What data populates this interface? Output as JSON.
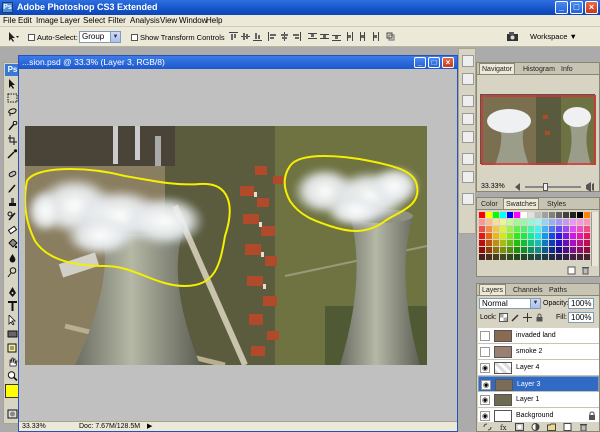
{
  "app": {
    "title": "Adobe Photoshop CS3 Extended",
    "logo": "Ps"
  },
  "menu": [
    "File",
    "Edit",
    "Image",
    "Layer",
    "Select",
    "Filter",
    "Analysis",
    "View",
    "Window",
    "Help"
  ],
  "options": {
    "auto_select_label": "Auto-Select:",
    "auto_select_value": "Group",
    "show_transform_label": "Show Transform Controls",
    "workspace_label": "Workspace"
  },
  "document": {
    "title": "...sion.psd @ 33.3% (Layer 3, RGB/8)",
    "zoom": "33.33%",
    "doc_size": "Doc: 7.67M/128.5M"
  },
  "navigator": {
    "tabs": [
      "Navigator",
      "Histogram",
      "Info"
    ],
    "zoom": "33.33%"
  },
  "swatches": {
    "tabs": [
      "Color",
      "Swatches",
      "Styles"
    ]
  },
  "layers_panel": {
    "tabs": [
      "Layers",
      "Channels",
      "Paths"
    ],
    "blend_mode": "Normal",
    "opacity_label": "Opacity:",
    "opacity_value": "100%",
    "lock_label": "Lock:",
    "fill_label": "Fill:",
    "fill_value": "100%",
    "layers": [
      {
        "name": "invaded land",
        "visible": false,
        "selected": false
      },
      {
        "name": "smoke 2",
        "visible": false,
        "selected": false
      },
      {
        "name": "Layer 4",
        "visible": true,
        "selected": false
      },
      {
        "name": "Layer 3",
        "visible": true,
        "selected": true
      },
      {
        "name": "Layer 1",
        "visible": true,
        "selected": false
      },
      {
        "name": "Background",
        "visible": true,
        "selected": false
      }
    ]
  },
  "colors": {
    "title_bar": "#1553c9",
    "foreground_color": "#ffff00",
    "selection": "#316ac5",
    "outline": "#f5f000"
  }
}
